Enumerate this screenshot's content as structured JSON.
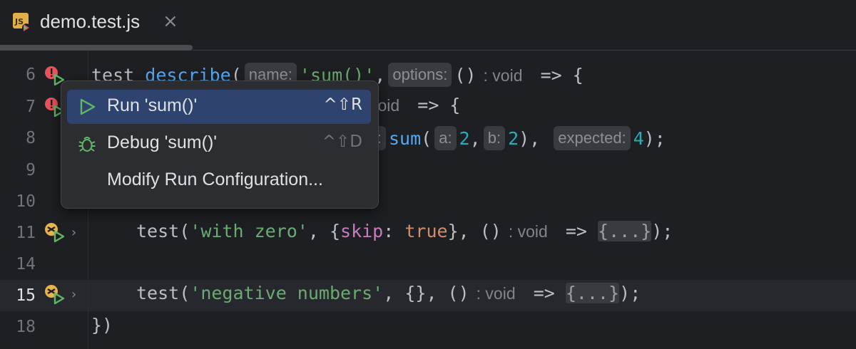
{
  "tab": {
    "filename": "demo.test.js",
    "close_glyph": "×"
  },
  "line_numbers": [
    "6",
    "7",
    "8",
    "9",
    "10",
    "11",
    "14",
    "15",
    "18"
  ],
  "code": {
    "l6": {
      "t1": "test",
      "t2": "describe",
      "hint_name": "name:",
      "str": "'sum()'",
      "hint_options": "options:",
      "arrow_part": "()",
      "type": ": void",
      "tail": "=> {"
    },
    "l7": {
      "type": "void",
      "tail": "=> {"
    },
    "l8": {
      "hint_l": "l:",
      "fn": "sum",
      "hint_a": "a:",
      "n1": "2",
      "hint_b": "b:",
      "n2": "2",
      "hint_expected": "expected:",
      "n3": "4"
    },
    "l11": {
      "fn": "test",
      "str": "'with zero'",
      "prop": "skip",
      "lit": "true",
      "parens": "()",
      "type": ": void",
      "arrow": "=>",
      "fold": "{...}"
    },
    "l15": {
      "fn": "test",
      "str": "'negative numbers'",
      "obj": "{}",
      "parens": "()",
      "type": ": void",
      "arrow": "=>",
      "fold": "{...}"
    },
    "l18": {
      "text": "})"
    }
  },
  "popup": {
    "items": [
      {
        "label": "Run 'sum()'",
        "shortcut": "^⇧R",
        "icon": "run-icon"
      },
      {
        "label": "Debug 'sum()'",
        "shortcut": "^⇧D",
        "icon": "debug-icon"
      },
      {
        "label": "Modify Run Configuration...",
        "shortcut": "",
        "icon": ""
      }
    ]
  },
  "colors": {
    "background": "#1e1f22",
    "accent_selected": "#2e436e",
    "run_green": "#5fb865",
    "error_red": "#e5545d",
    "warning_yellow": "#e8b34a"
  }
}
